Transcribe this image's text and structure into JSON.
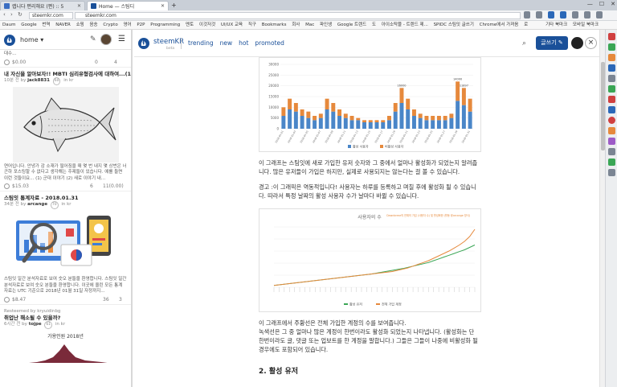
{
  "browser": {
    "tabs": [
      {
        "label": "랩니다 편리해요 (편) :: 5"
      },
      {
        "label": "Home — 스팀디"
      }
    ],
    "address_short": "steemkr.com",
    "address_full": "steemkr.com",
    "bookmarks": [
      "Daum",
      "Google",
      "번역",
      "NAVER",
      "쇼핑",
      "음송",
      "Crypto",
      "영어",
      "P2P",
      "Programming",
      "멘토",
      "이것저것",
      "UI/UX 교육",
      "직구",
      "Bookmarks",
      "회사",
      "Mac",
      "파인생",
      "Google 트렌드",
      "도",
      "아이소탁블 - 트렌드 제...",
      "SPIDC 스팀잇 글쓰기",
      "Chrome에서 가져옴",
      "로"
    ],
    "bookmarks_right": [
      "기타 북마크",
      "모바일 북마크"
    ]
  },
  "sidebar": {
    "home_label": "home",
    "top_item": {
      "payout": "$0.00",
      "votes": "0",
      "comments": "4",
      "snippet": "대수..."
    },
    "posts": [
      {
        "title": "내 자신을 알아보자!! MBTI 심리유형검사에 대하여...(1)",
        "time": "10분 전 by",
        "author": "jack8831",
        "rep": "60",
        "category": "in kr",
        "desc": "연어입니다. 안녕가 감 소재가 떨어짐을 때 몇 번 내지 몇 상번은 너 곤하 포스팅할 수 없다고 생각해는 주제들이 있습니다. 예를 들면 이런 것들이요... (1) 군대 이야기 (2) 새로 이야기 내...",
        "payout": "$15.03",
        "votes": "6",
        "comments": "11(0.00)"
      },
      {
        "title": "스팀잇 통계자료 - 2018.01.31",
        "time": "34분 전 by",
        "author": "arcange",
        "rep": "70",
        "category": "in kr",
        "desc": "스팀잇 일간 분석자료로 보여 숫오 분들을 환영합니다. 스팀잇 일간 분석자료로 보여 숫오 분들을 환영합니다. 이곳에 올린 모든 통계 자료는 UTC 기준으로 2018년 01월 31일 자정까지...",
        "payout": "$8.47",
        "votes": "36",
        "comments": "3"
      },
      {
        "resteem": "Resteemed by kryuidinbg",
        "title": "취업난 해소될 수 있을까?",
        "time": "6시간 전 by",
        "author": "tojpe",
        "rep": "61",
        "category": "in kr",
        "chart_title": "가용인원 2018년"
      }
    ]
  },
  "main": {
    "brand": "steemKR",
    "beta": "beta",
    "nav": [
      "trending",
      "new",
      "hot",
      "promoted"
    ],
    "write_label": "글쓰기",
    "para1": "이 그래프는 스팀잇에 새로 가입한 유저 숫자와 그 중에서 얼마나 활성화가 되었는지 알려줍니다. 많은 유저들이 가입은 하지만, 실제로 사용되지는 않는다는 걸 볼 수 있습니다.",
    "para2": "경고 :이 그래픽은 역동적입니다! 사용자는 하루를 등록하고 며칠 후에 활성화 될 수 있습니다. 따라서 특정 날짜의 활성 사용자 수가 날마다 바뀔 수 있습니다.",
    "para3": "이 그래프에서 주황선은 전체 가입한 계정의 수를 보여줍니다.",
    "para4": "녹색선은 그 중 얼마나 많은 계정이 한번이라도 활성화 되었는지 나타냅니다. (활성화는 단 한번이라도 글, 댓글 또는 업보트를 한 계정을 말합니다.) 그들은 그들이 나중에 비활성화 될 경우에도 포함되어 있습니다.",
    "heading": "2. 활성 유저"
  },
  "chart_data": [
    {
      "type": "bar",
      "stacked": true,
      "x": [
        "2018-01-01",
        "2018-01-02",
        "2018-01-03",
        "2018-01-04",
        "2018-01-05",
        "2018-01-06",
        "2018-01-07",
        "2018-01-08",
        "2018-01-09",
        "2018-01-10",
        "2018-01-11",
        "2018-01-12",
        "2018-01-13",
        "2018-01-14",
        "2018-01-15",
        "2018-01-16",
        "2018-01-17",
        "2018-01-18",
        "2018-01-19",
        "2018-01-20",
        "2018-01-21",
        "2018-01-22",
        "2018-01-23",
        "2018-01-24",
        "2018-01-25",
        "2018-01-26",
        "2018-01-27",
        "2018-01-28",
        "2018-01-29",
        "2018-01-30",
        "2018-01-31"
      ],
      "series": [
        {
          "name": "활성 사용자",
          "color": "#4a86c8",
          "values": [
            6000,
            9000,
            8000,
            6000,
            5000,
            4000,
            5000,
            9000,
            8000,
            6000,
            5000,
            4000,
            4000,
            3000,
            3000,
            3000,
            3000,
            4000,
            8000,
            12000,
            9000,
            6000,
            5000,
            4000,
            4000,
            4000,
            4000,
            5000,
            13000,
            11000,
            8000
          ]
        },
        {
          "name": "비활성 사용자",
          "color": "#e6893c",
          "values": [
            4000,
            5000,
            4000,
            3000,
            3000,
            2000,
            2000,
            5000,
            4000,
            3000,
            2000,
            2000,
            1000,
            1000,
            1000,
            1000,
            1000,
            2000,
            4000,
            7000,
            5000,
            3000,
            2000,
            2000,
            2000,
            2000,
            2000,
            2000,
            9000,
            8000,
            6000
          ]
        }
      ],
      "ylim": [
        0,
        30000
      ],
      "yticks": [
        0,
        5000,
        10000,
        15000,
        20000,
        25000,
        30000
      ],
      "legend": "bottom",
      "annotations": [
        "16000",
        "14000",
        "11897"
      ]
    },
    {
      "type": "line",
      "title": "사용자의 수",
      "legend_top": "Dawnbreez의 전체의 가입 (사용자 수) 및 활성화한 (활동 @arcange 방식)",
      "series": [
        {
          "name": "활성 유저",
          "color": "#3aa655",
          "values": [
            0.3,
            0.4,
            0.5,
            0.6,
            0.7,
            0.8,
            0.9,
            1.0,
            1.1,
            1.2,
            1.3,
            1.4,
            1.5,
            1.6,
            1.7,
            1.8,
            1.9,
            2.0,
            2.1,
            2.2,
            2.35,
            2.5,
            2.65,
            2.8,
            2.95,
            3.1,
            3.3,
            3.5,
            3.7,
            3.9,
            4.1,
            4.4,
            4.7,
            5.0,
            5.3,
            5.6,
            5.9,
            6.2,
            6.6,
            7.0
          ]
        },
        {
          "name": "전체 가입 계정",
          "color": "#e6893c",
          "values": [
            0.3,
            0.4,
            0.5,
            0.6,
            0.7,
            0.8,
            0.9,
            1.0,
            1.1,
            1.2,
            1.3,
            1.4,
            1.5,
            1.6,
            1.7,
            1.8,
            1.9,
            2.0,
            2.1,
            2.2,
            2.3,
            2.4,
            2.5,
            2.6,
            2.8,
            3.0,
            3.2,
            3.5,
            3.8,
            4.1,
            4.4,
            4.8,
            5.2,
            5.6,
            6.0,
            6.5,
            7.0,
            7.6,
            8.4,
            9.6
          ]
        }
      ],
      "ylim": [
        0,
        10
      ],
      "legend": "bottom"
    }
  ],
  "colors": {
    "steem_blue": "#1a5099",
    "orange": "#e6893c",
    "green": "#3aa655",
    "bar_blue": "#4a86c8"
  }
}
